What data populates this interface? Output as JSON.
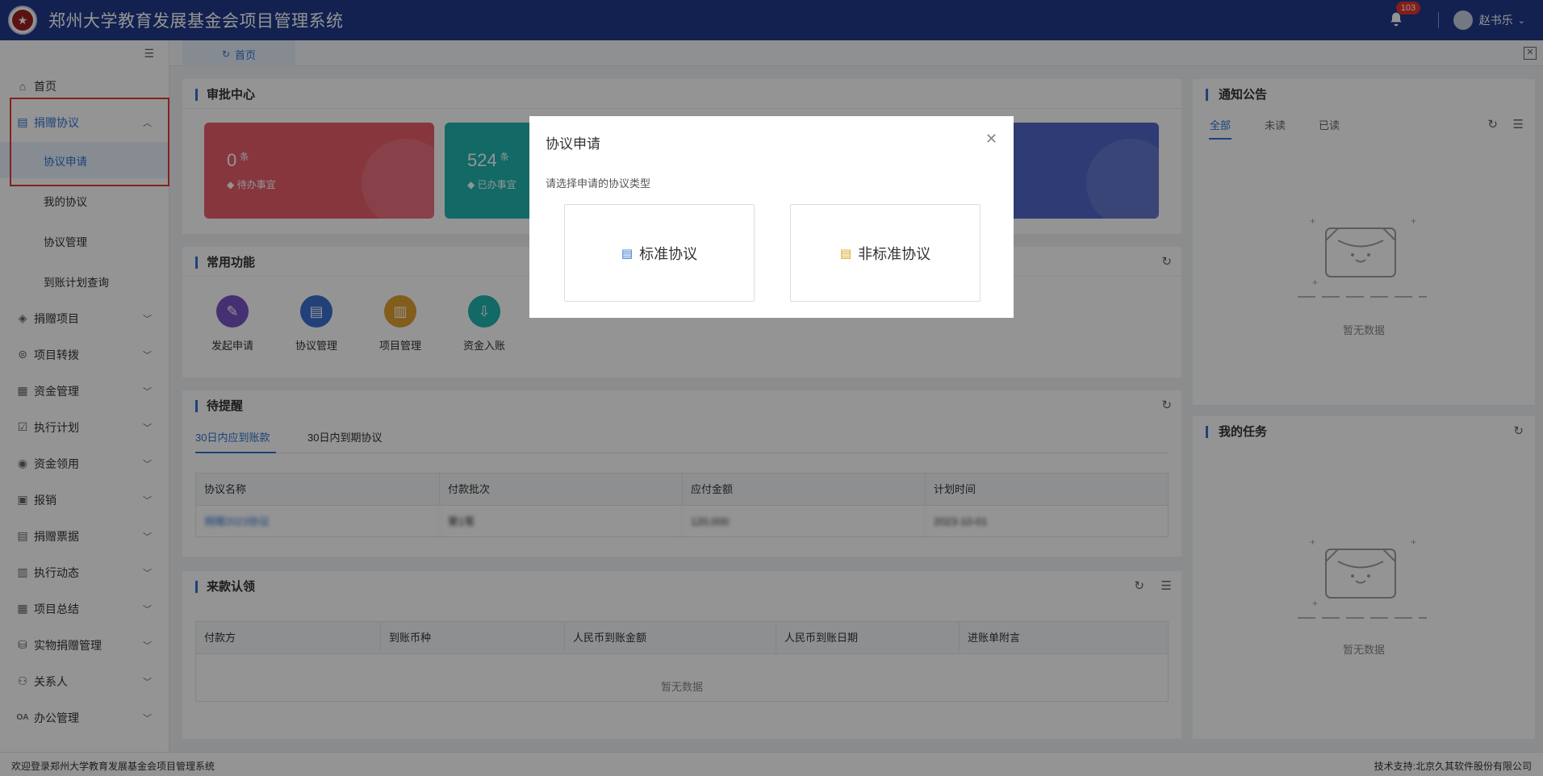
{
  "header": {
    "title": "郑州大学教育发展基金会项目管理系统",
    "notification_count": "103",
    "user_name": "赵书乐"
  },
  "sidebar": {
    "items": [
      {
        "label": "首页",
        "icon": "home-icon"
      },
      {
        "label": "捐赠协议",
        "icon": "document-icon",
        "expanded": true,
        "children": [
          "协议申请",
          "我的协议",
          "协议管理",
          "到账计划查询"
        ]
      },
      {
        "label": "捐赠项目",
        "icon": "layers-icon"
      },
      {
        "label": "项目转拨",
        "icon": "transfer-icon"
      },
      {
        "label": "资金管理",
        "icon": "finance-icon"
      },
      {
        "label": "执行计划",
        "icon": "calendar-check-icon"
      },
      {
        "label": "资金领用",
        "icon": "money-user-icon"
      },
      {
        "label": "报销",
        "icon": "receipt-icon"
      },
      {
        "label": "捐赠票据",
        "icon": "invoice-icon"
      },
      {
        "label": "执行动态",
        "icon": "activity-icon"
      },
      {
        "label": "项目总结",
        "icon": "summary-icon"
      },
      {
        "label": "实物捐赠管理",
        "icon": "gift-icon"
      },
      {
        "label": "关系人",
        "icon": "contacts-icon"
      },
      {
        "label": "办公管理",
        "icon": "oa-icon"
      }
    ],
    "active_child": "协议申请"
  },
  "tabs": {
    "home": "首页"
  },
  "approval": {
    "title": "审批中心",
    "cards": [
      {
        "value": "0",
        "unit": "条",
        "label": "待办事宜",
        "color": "#e85d6c"
      },
      {
        "value": "524",
        "unit": "条",
        "label": "已办事宜",
        "color": "#1fb5b0"
      }
    ]
  },
  "common": {
    "title": "常用功能",
    "items": [
      {
        "label": "发起申请",
        "color": "#7b52c6",
        "icon": "pencil-icon"
      },
      {
        "label": "协议管理",
        "color": "#3b6fd1",
        "icon": "agreement-icon"
      },
      {
        "label": "项目管理",
        "color": "#e0a030",
        "icon": "project-icon"
      },
      {
        "label": "资金入账",
        "color": "#1fb5b0",
        "icon": "deposit-icon"
      }
    ]
  },
  "reminder": {
    "title": "待提醒",
    "tabs": [
      "30日内应到账款",
      "30日内到期协议"
    ],
    "columns": [
      "协议名称",
      "付款批次",
      "应付金额",
      "计划时间"
    ],
    "rows": [
      [
        "捐赠2023协议",
        "第1笔",
        "120,000",
        "2023-10-01"
      ]
    ]
  },
  "incoming": {
    "title": "来款认领",
    "columns": [
      "付款方",
      "到账币种",
      "人民币到账金额",
      "人民币到账日期",
      "进账单附言"
    ],
    "empty": "暂无数据"
  },
  "notice": {
    "title": "通知公告",
    "tabs": [
      "全部",
      "未读",
      "已读"
    ],
    "empty": "暂无数据"
  },
  "tasks": {
    "title": "我的任务",
    "empty": "暂无数据"
  },
  "modal": {
    "title": "协议申请",
    "hint": "请选择申请的协议类型",
    "options": [
      "标准协议",
      "非标准协议"
    ]
  },
  "footer": {
    "left": "欢迎登录郑州大学教育发展基金会项目管理系统",
    "right": "技术支持:北京久其软件股份有限公司"
  }
}
